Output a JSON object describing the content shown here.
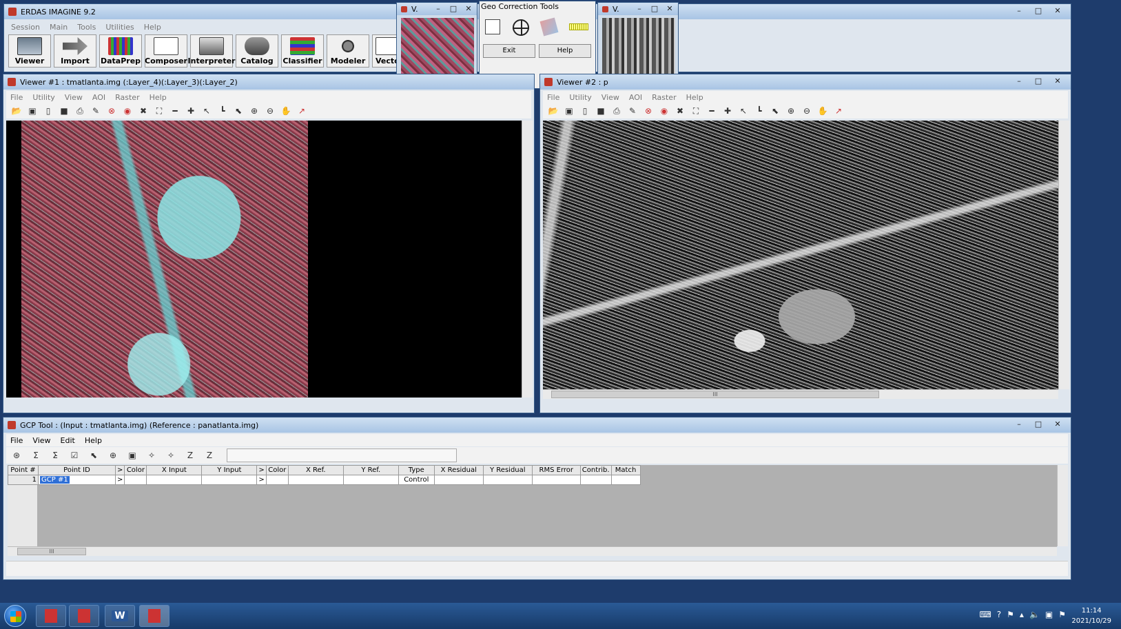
{
  "app": {
    "title": "ERDAS IMAGINE 9.2",
    "menu": [
      "Session",
      "Main",
      "Tools",
      "Utilities",
      "Help"
    ],
    "toolbar": [
      "Viewer",
      "Import",
      "DataPrep",
      "Composer",
      "Interpreter",
      "Catalog",
      "Classifier",
      "Modeler",
      "Vector"
    ]
  },
  "mini_viewer_left": {
    "title": "V."
  },
  "mini_viewer_right": {
    "title": "V."
  },
  "geo_correction": {
    "title": "Geo Correction Tools",
    "exit_label": "Exit",
    "help_label": "Help"
  },
  "viewer1": {
    "title": "Viewer #1 : tmatlanta.img (:Layer_4)(:Layer_3)(:Layer_2)",
    "menu": [
      "File",
      "Utility",
      "View",
      "AOI",
      "Raster",
      "Help"
    ]
  },
  "viewer2": {
    "title": "Viewer #2 : p",
    "menu": [
      "File",
      "Utility",
      "View",
      "AOI",
      "Raster",
      "Help"
    ],
    "hscroll_grip": "III"
  },
  "gcp_tool": {
    "title": "GCP Tool : (Input : tmatlanta.img) (Reference : panatlanta.img)",
    "menu": [
      "File",
      "View",
      "Edit",
      "Help"
    ],
    "columns": [
      "Point #",
      "Point ID",
      ">",
      "Color",
      "X Input",
      "Y Input",
      ">",
      "Color",
      "X Ref.",
      "Y Ref.",
      "Type",
      "X Residual",
      "Y Residual",
      "RMS Error",
      "Contrib.",
      "Match"
    ],
    "rows": [
      {
        "num": "1",
        "id": "GCP #1",
        "arrow1": ">",
        "arrow2": ">",
        "type": "Control"
      }
    ],
    "hscroll_grip": "III"
  },
  "taskbar": {
    "time": "11:14",
    "date": "2021/10/29",
    "word_label": "W"
  },
  "colors": {
    "title_gradient_top": "#cfe0f2",
    "title_gradient_bottom": "#a8c4e4",
    "desktop": "#1e3c6c",
    "taskbar": "#1f4a80",
    "selection": "#2f6fd6"
  },
  "icons": {
    "toolbar_icons": [
      "open-folder-icon",
      "folder-icon",
      "page-icon",
      "save-icon",
      "print-icon",
      "eraser-icon",
      "clear-icon",
      "fill-icon",
      "fit-icon",
      "zoom-extent-icon",
      "ruler-icon",
      "crosshair-icon",
      "pick-icon",
      "profile-icon",
      "pointer-icon",
      "zoom-in-icon",
      "zoom-out-icon",
      "pan-hand-icon",
      "inquire-icon"
    ]
  }
}
